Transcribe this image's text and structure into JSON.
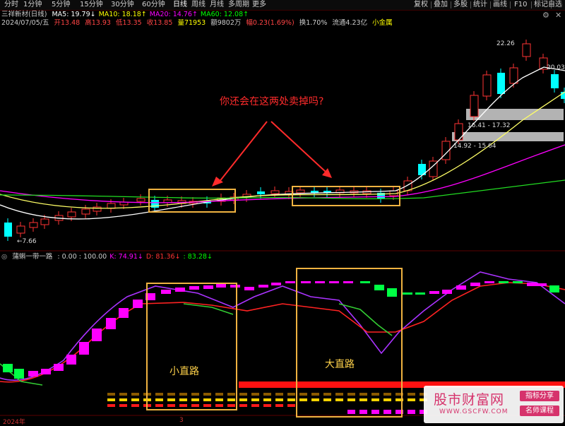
{
  "toolbar": {
    "periods": [
      "分时",
      "1分钟",
      "5分钟",
      "15分钟",
      "30分钟",
      "60分钟",
      "日线",
      "周线",
      "月线",
      "多周期",
      "更多"
    ],
    "selected_period": "日线",
    "right_items": [
      "复权",
      "叠加",
      "多股",
      "统计",
      "画线",
      "F10",
      "标记",
      "自选"
    ]
  },
  "window": {
    "settings_icon": "gear-icon",
    "close_icon": "close-icon"
  },
  "main_panel": {
    "stock_name": "三祥新材(日线)",
    "ma": [
      {
        "label": "MA5: 19.79",
        "arrow": "↓",
        "color": "#ffffff"
      },
      {
        "label": "MA10: 18.18",
        "arrow": "↑",
        "color": "#ffff00"
      },
      {
        "label": "MA20: 14.76",
        "arrow": "↑",
        "color": "#ff00ff"
      },
      {
        "label": "MA60: 12.08",
        "arrow": "↑",
        "color": "#00ff00"
      }
    ],
    "info": {
      "date": "2024/07/05/五",
      "open": "开13.48",
      "high": "高13.93",
      "low": "低13.35",
      "close": "收13.85",
      "volume": "量71953",
      "amount": "额9802万",
      "change": "幅0.23(1.69%)",
      "turnover": "换1.70%",
      "float_cap": "流通4.23亿",
      "category": "小金属"
    },
    "price_labels": {
      "high_mark": "22.26",
      "last_mark": "20.03",
      "low_mark": "←7.66",
      "zone1": "16.41 - 17.32",
      "zone2": "14.92 - 15.64"
    },
    "annotation": "你还会在这两处卖掉吗?"
  },
  "sub_panel": {
    "indicator_name": "蒲蝌一带一路",
    "values": [
      {
        "label": ": 0.00 : 100.00",
        "color": "#cccccc"
      },
      {
        "label": "K: 74.91",
        "arrow": "↓",
        "color": "#ff00ff"
      },
      {
        "label": "D: 81.36",
        "arrow": "↓",
        "color": "#ff3333"
      },
      {
        "label": ": 83.28",
        "arrow": "↓",
        "color": "#00ff00"
      }
    ],
    "box_labels": [
      "小直路",
      "大直路"
    ]
  },
  "bottom_axis": {
    "year_label": "2024年",
    "mid_label": "3"
  },
  "watermark": {
    "title": "股市财富网",
    "url": "WWW.GSCFW.COM",
    "tag1": "指标分享",
    "tag2": "名师课程"
  },
  "colors": {
    "up": "#ff3333",
    "down": "#00ffff",
    "box": "#f0b341",
    "arrow": "#ff2b2b"
  }
}
